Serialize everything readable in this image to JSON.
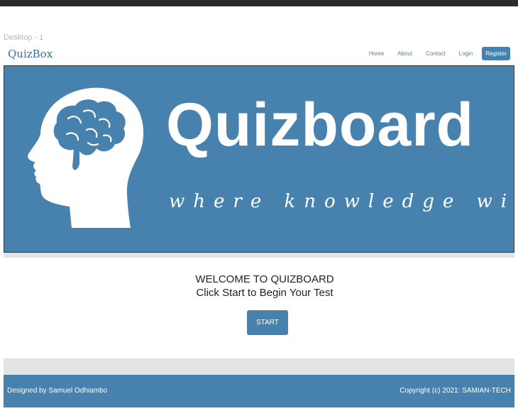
{
  "frame_label": "Desktop - 1",
  "navbar": {
    "brand": "QuizBox",
    "links": [
      "Home",
      "About",
      "Contact",
      "Login"
    ],
    "register": "Register"
  },
  "banner": {
    "title": "Quizboard",
    "tagline": "where knowledge wins",
    "icon": "head-brain-logo-icon"
  },
  "main": {
    "welcome": "WELCOME TO QUIZBOARD",
    "instruction": "Click Start to Begin Your Test",
    "start_label": "START"
  },
  "footer": {
    "designer": "Designed by Samuel Odhiambo",
    "copyright": "Copyright (c) 2021: SAMIAN-TECH"
  },
  "colors": {
    "primary": "#4682ad",
    "topbar": "#2b2b2b",
    "gray_band": "#e4e4e4",
    "brand_text": "#3a6f97"
  }
}
